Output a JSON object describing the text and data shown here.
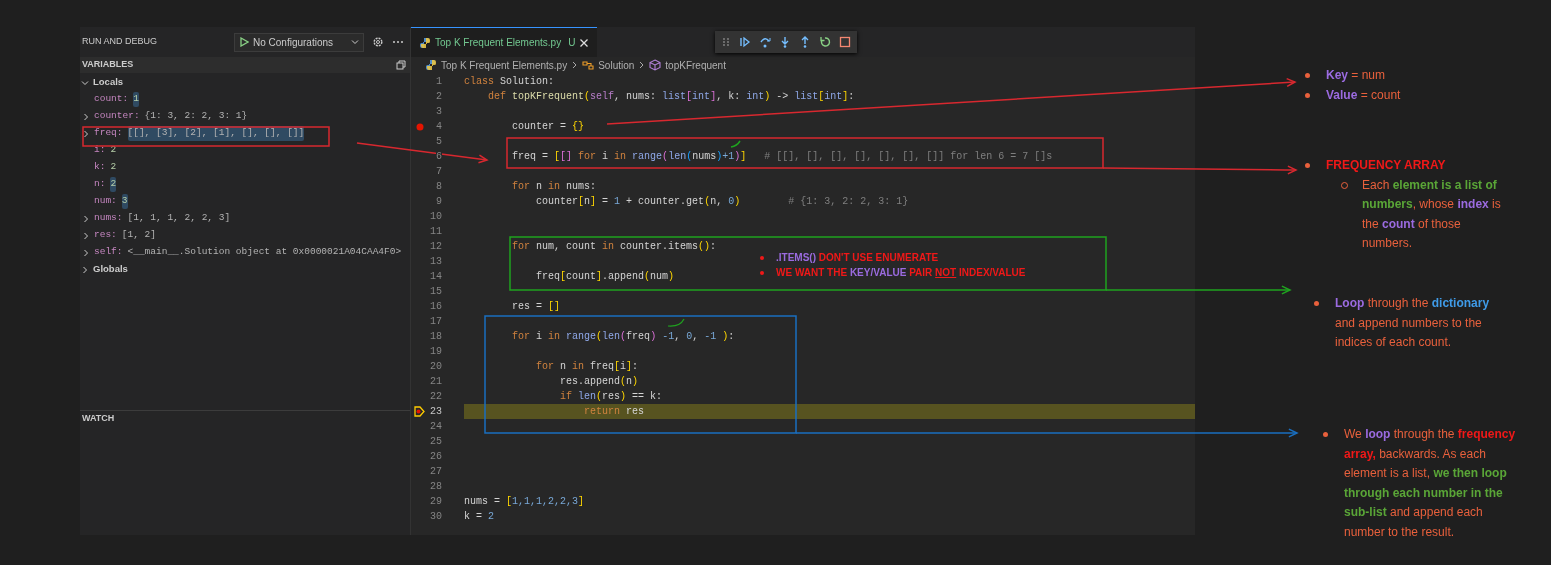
{
  "sidebar": {
    "title": "RUN AND DEBUG",
    "config": "No Configurations",
    "variables": {
      "header": "VARIABLES",
      "scopes": [
        {
          "label": "Locals",
          "expanded": true,
          "children": [
            {
              "name": "count:",
              "value": "1",
              "expandable": false,
              "changed": true,
              "kind": "number"
            },
            {
              "name": "counter:",
              "value": "{1: 3, 2: 2, 3: 1}",
              "expandable": true,
              "changed": false,
              "kind": "object"
            },
            {
              "name": "freq:",
              "value": "[[], [3], [2], [1], [], [], []]",
              "expandable": true,
              "changed": true,
              "kind": "object"
            },
            {
              "name": "i:",
              "value": "2",
              "expandable": false,
              "changed": false,
              "kind": "number"
            },
            {
              "name": "k:",
              "value": "2",
              "expandable": false,
              "changed": false,
              "kind": "number"
            },
            {
              "name": "n:",
              "value": "2",
              "expandable": false,
              "changed": true,
              "kind": "number"
            },
            {
              "name": "num:",
              "value": "3",
              "expandable": false,
              "changed": true,
              "kind": "number"
            },
            {
              "name": "nums:",
              "value": "[1, 1, 1, 2, 2, 3]",
              "expandable": true,
              "changed": false,
              "kind": "object"
            },
            {
              "name": "res:",
              "value": "[1, 2]",
              "expandable": true,
              "changed": false,
              "kind": "object"
            },
            {
              "name": "self:",
              "value": "<__main__.Solution object at 0x0000021A04CAA4F0>",
              "expandable": true,
              "changed": false,
              "kind": "object"
            }
          ]
        },
        {
          "label": "Globals",
          "expanded": false
        }
      ]
    },
    "watch": {
      "header": "WATCH"
    }
  },
  "editor": {
    "tab": {
      "label": "Top K Frequent Elements.py",
      "badge": "U",
      "selected": true
    },
    "breadcrumb": [
      "Top K Frequent Elements.py",
      "Solution",
      "topKFrequent"
    ],
    "lines": [
      {
        "n": "1",
        "breakpoint": false,
        "current": false,
        "tokens": [
          {
            "text": "class",
            "kind": "kw"
          },
          {
            "text": " Solution:",
            "kind": "p"
          }
        ]
      },
      {
        "n": "2",
        "breakpoint": false,
        "current": false,
        "tokens": [
          {
            "text": "    def",
            "kind": "kw"
          },
          {
            "text": " topKFrequent",
            "kind": "fn"
          },
          {
            "text": "(",
            "kind": "b1"
          },
          {
            "text": "self",
            "kind": "self"
          },
          {
            "text": ", nums: ",
            "kind": "p"
          },
          {
            "text": "list",
            "kind": "type"
          },
          {
            "text": "[",
            "kind": "b2"
          },
          {
            "text": "int",
            "kind": "type"
          },
          {
            "text": "]",
            "kind": "b2"
          },
          {
            "text": ", k: ",
            "kind": "p"
          },
          {
            "text": "int",
            "kind": "type"
          },
          {
            "text": ")",
            "kind": "b1"
          },
          {
            "text": " -> ",
            "kind": "p"
          },
          {
            "text": "list",
            "kind": "type"
          },
          {
            "text": "[",
            "kind": "b1"
          },
          {
            "text": "int",
            "kind": "type"
          },
          {
            "text": "]",
            "kind": "b1"
          },
          {
            "text": ":",
            "kind": "p"
          }
        ]
      },
      {
        "n": "3",
        "breakpoint": false,
        "current": false
      },
      {
        "n": "4",
        "breakpoint": true,
        "current": false,
        "tokens": [
          {
            "text": "        counter = ",
            "kind": "p"
          },
          {
            "text": "{}",
            "kind": "b1"
          }
        ]
      },
      {
        "n": "5",
        "breakpoint": false,
        "current": false
      },
      {
        "n": "6",
        "breakpoint": false,
        "current": false,
        "tokens": [
          {
            "text": "        freq = ",
            "kind": "p"
          },
          {
            "text": "[",
            "kind": "b1"
          },
          {
            "text": "[]",
            "kind": "b2"
          },
          {
            "text": " for",
            "kind": "kw"
          },
          {
            "text": " i ",
            "kind": "p"
          },
          {
            "text": "in",
            "kind": "kw"
          },
          {
            "text": " range",
            "kind": "type"
          },
          {
            "text": "(",
            "kind": "b2"
          },
          {
            "text": "len",
            "kind": "type"
          },
          {
            "text": "(",
            "kind": "b3"
          },
          {
            "text": "nums",
            "kind": "p"
          },
          {
            "text": ")",
            "kind": "b3"
          },
          {
            "text": "+1",
            "kind": "num"
          },
          {
            "text": ")",
            "kind": "b2"
          },
          {
            "text": "]",
            "kind": "b1"
          },
          {
            "text": "   # [[], [], [], [], [], [], []] for len 6 = 7 []s",
            "kind": "cmt"
          }
        ]
      },
      {
        "n": "7",
        "breakpoint": false,
        "current": false
      },
      {
        "n": "8",
        "breakpoint": false,
        "current": false,
        "tokens": [
          {
            "text": "        for",
            "kind": "kw"
          },
          {
            "text": " n ",
            "kind": "p"
          },
          {
            "text": "in",
            "kind": "kw"
          },
          {
            "text": " nums:",
            "kind": "p"
          }
        ]
      },
      {
        "n": "9",
        "breakpoint": false,
        "current": false,
        "tokens": [
          {
            "text": "            counter",
            "kind": "p"
          },
          {
            "text": "[",
            "kind": "b1"
          },
          {
            "text": "n",
            "kind": "p"
          },
          {
            "text": "]",
            "kind": "b1"
          },
          {
            "text": " = ",
            "kind": "p"
          },
          {
            "text": "1",
            "kind": "num"
          },
          {
            "text": " + counter.get",
            "kind": "p"
          },
          {
            "text": "(",
            "kind": "b1"
          },
          {
            "text": "n, ",
            "kind": "p"
          },
          {
            "text": "0",
            "kind": "num"
          },
          {
            "text": ")",
            "kind": "b1"
          },
          {
            "text": "        # {1: 3, 2: 2, 3: 1}",
            "kind": "cmt"
          }
        ]
      },
      {
        "n": "10",
        "breakpoint": false,
        "current": false
      },
      {
        "n": "11",
        "breakpoint": false,
        "current": false
      },
      {
        "n": "12",
        "breakpoint": false,
        "current": false,
        "tokens": [
          {
            "text": "        for",
            "kind": "kw"
          },
          {
            "text": " num, count ",
            "kind": "p"
          },
          {
            "text": "in",
            "kind": "kw"
          },
          {
            "text": " counter.items",
            "kind": "p"
          },
          {
            "text": "()",
            "kind": "b1"
          },
          {
            "text": ":",
            "kind": "p"
          }
        ]
      },
      {
        "n": "13",
        "breakpoint": false,
        "current": false
      },
      {
        "n": "14",
        "breakpoint": false,
        "current": false,
        "tokens": [
          {
            "text": "            freq",
            "kind": "p"
          },
          {
            "text": "[",
            "kind": "b1"
          },
          {
            "text": "count",
            "kind": "p"
          },
          {
            "text": "]",
            "kind": "b1"
          },
          {
            "text": ".append",
            "kind": "p"
          },
          {
            "text": "(",
            "kind": "b1"
          },
          {
            "text": "num",
            "kind": "p"
          },
          {
            "text": ")",
            "kind": "b1"
          }
        ]
      },
      {
        "n": "15",
        "breakpoint": false,
        "current": false
      },
      {
        "n": "16",
        "breakpoint": false,
        "current": false,
        "tokens": [
          {
            "text": "        res = ",
            "kind": "p"
          },
          {
            "text": "[]",
            "kind": "b1"
          }
        ]
      },
      {
        "n": "17",
        "breakpoint": false,
        "current": false
      },
      {
        "n": "18",
        "breakpoint": false,
        "current": false,
        "tokens": [
          {
            "text": "        for",
            "kind": "kw"
          },
          {
            "text": " i ",
            "kind": "p"
          },
          {
            "text": "in",
            "kind": "kw"
          },
          {
            "text": " range",
            "kind": "type"
          },
          {
            "text": "(",
            "kind": "b1"
          },
          {
            "text": "len",
            "kind": "type"
          },
          {
            "text": "(",
            "kind": "b2"
          },
          {
            "text": "freq",
            "kind": "p"
          },
          {
            "text": ")",
            "kind": "b2"
          },
          {
            "text": " -1",
            "kind": "num"
          },
          {
            "text": ", ",
            "kind": "p"
          },
          {
            "text": "0",
            "kind": "num"
          },
          {
            "text": ", ",
            "kind": "p"
          },
          {
            "text": "-1",
            "kind": "num"
          },
          {
            "text": " )",
            "kind": "b1"
          },
          {
            "text": ":",
            "kind": "p"
          }
        ]
      },
      {
        "n": "19",
        "breakpoint": false,
        "current": false
      },
      {
        "n": "20",
        "breakpoint": false,
        "current": false,
        "tokens": [
          {
            "text": "            for",
            "kind": "kw"
          },
          {
            "text": " n ",
            "kind": "p"
          },
          {
            "text": "in",
            "kind": "kw"
          },
          {
            "text": " freq",
            "kind": "p"
          },
          {
            "text": "[",
            "kind": "b1"
          },
          {
            "text": "i",
            "kind": "p"
          },
          {
            "text": "]",
            "kind": "b1"
          },
          {
            "text": ":",
            "kind": "p"
          }
        ]
      },
      {
        "n": "21",
        "breakpoint": false,
        "current": false,
        "tokens": [
          {
            "text": "                res.append",
            "kind": "p"
          },
          {
            "text": "(",
            "kind": "b1"
          },
          {
            "text": "n",
            "kind": "p"
          },
          {
            "text": ")",
            "kind": "b1"
          }
        ]
      },
      {
        "n": "22",
        "breakpoint": false,
        "current": false,
        "tokens": [
          {
            "text": "                if",
            "kind": "kw"
          },
          {
            "text": " len",
            "kind": "type"
          },
          {
            "text": "(",
            "kind": "b1"
          },
          {
            "text": "res",
            "kind": "p"
          },
          {
            "text": ")",
            "kind": "b1"
          },
          {
            "text": " == k:",
            "kind": "p"
          }
        ]
      },
      {
        "n": "23",
        "breakpoint": true,
        "current": true,
        "tokens": [
          {
            "text": "                    return",
            "kind": "kw"
          },
          {
            "text": " res",
            "kind": "p"
          }
        ]
      },
      {
        "n": "24",
        "breakpoint": false,
        "current": false
      },
      {
        "n": "25",
        "breakpoint": false,
        "current": false
      },
      {
        "n": "26",
        "breakpoint": false,
        "current": false
      },
      {
        "n": "27",
        "breakpoint": false,
        "current": false
      },
      {
        "n": "28",
        "breakpoint": false,
        "current": false
      },
      {
        "n": "29",
        "breakpoint": false,
        "current": false,
        "tokens": [
          {
            "text": "nums = ",
            "kind": "p"
          },
          {
            "text": "[",
            "kind": "b1"
          },
          {
            "text": "1,1,1,2,2,3",
            "kind": "num"
          },
          {
            "text": "]",
            "kind": "b1"
          }
        ]
      },
      {
        "n": "30",
        "breakpoint": false,
        "current": false,
        "tokens": [
          {
            "text": "k = ",
            "kind": "p"
          },
          {
            "text": "2",
            "kind": "num"
          }
        ]
      }
    ]
  },
  "annotations": {
    "inline_notes": [
      {
        "bold": true,
        "segments": [
          {
            "text": ".ITEMS()",
            "color": "#9b6be0"
          },
          {
            "text": " DON'T USE ENUMERATE",
            "color": "#f01818"
          }
        ]
      },
      {
        "bold": true,
        "segments": [
          {
            "text": "WE WANT THE ",
            "color": "#f01818"
          },
          {
            "text": "KEY/VALUE",
            "color": "#9b6be0"
          },
          {
            "text": " PAIR ",
            "color": "#f01818"
          },
          {
            "text": "NOT",
            "color": "#f01818",
            "underline": true
          },
          {
            "text": " INDEX/VALUE",
            "color": "#f01818"
          }
        ]
      }
    ],
    "side_notes": [
      {
        "items": [
          {
            "segments": [
              {
                "text": "Key",
                "color": "#9b6be0",
                "bold": true
              },
              {
                "text": " = num",
                "color": "#e8603c"
              }
            ]
          },
          {
            "segments": [
              {
                "text": "Value",
                "color": "#9b6be0",
                "bold": true
              },
              {
                "text": " = count",
                "color": "#e8603c"
              }
            ]
          }
        ]
      },
      {
        "items": [
          {
            "segments": [
              {
                "text": "FREQUENCY ARRAY",
                "color": "#f01818",
                "bold": true
              }
            ],
            "children": [
              {
                "segments": [
                  {
                    "text": "Each ",
                    "color": "#e8603c"
                  },
                  {
                    "text": "element is a list of numbers",
                    "color": "#5aa637",
                    "bold": true
                  },
                  {
                    "text": ", whose ",
                    "color": "#e8603c"
                  },
                  {
                    "text": "index",
                    "color": "#9b6be0",
                    "bold": true
                  },
                  {
                    "text": " is the ",
                    "color": "#e8603c"
                  },
                  {
                    "text": "count",
                    "color": "#9b6be0",
                    "bold": true
                  },
                  {
                    "text": " of those numbers.",
                    "color": "#e8603c"
                  }
                ]
              }
            ]
          }
        ]
      },
      {
        "items": [
          {
            "segments": [
              {
                "text": "Loop",
                "color": "#9b6be0",
                "bold": true
              },
              {
                "text": " through the ",
                "color": "#e8603c"
              },
              {
                "text": "dictionary",
                "color": "#3f9be8",
                "bold": true
              },
              {
                "text": " and append numbers to the indices of each count.",
                "color": "#e8603c"
              }
            ]
          }
        ]
      },
      {
        "items": [
          {
            "segments": [
              {
                "text": "We ",
                "color": "#e8603c"
              },
              {
                "text": "loop",
                "color": "#9b6be0",
                "bold": true
              },
              {
                "text": " through the ",
                "color": "#e8603c"
              },
              {
                "text": "frequency array,",
                "color": "#f01818",
                "bold": true
              },
              {
                "text": " backwards.  As each element is a list, ",
                "color": "#e8603c"
              },
              {
                "text": "we then loop through each number in the sub-list",
                "color": "#5aa637",
                "bold": true
              },
              {
                "text": " and append each number to the result.",
                "color": "#e8603c"
              }
            ]
          }
        ]
      }
    ]
  }
}
